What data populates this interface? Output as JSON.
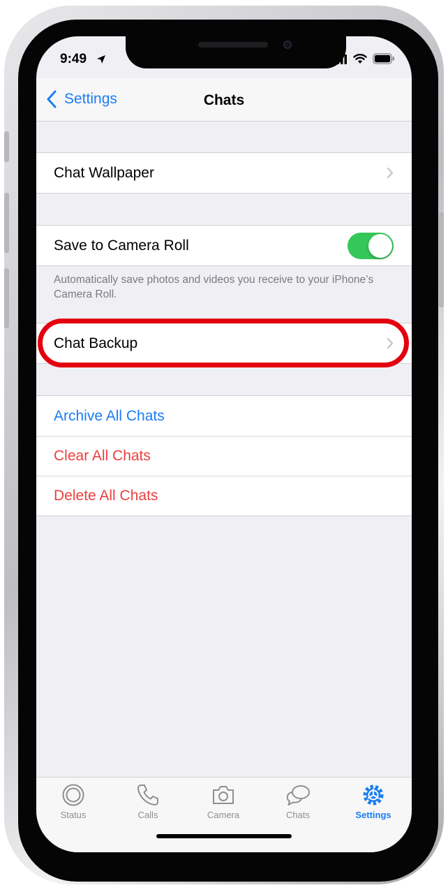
{
  "status_bar": {
    "time": "9:49"
  },
  "navbar": {
    "back_label": "Settings",
    "title": "Chats"
  },
  "group_wallpaper": {
    "label": "Chat Wallpaper"
  },
  "group_camera_roll": {
    "label": "Save to Camera Roll",
    "toggle_on": true,
    "footnote": "Automatically save photos and videos you receive to your iPhone’s Camera Roll."
  },
  "group_backup": {
    "label": "Chat Backup"
  },
  "group_actions": {
    "archive": "Archive All Chats",
    "clear": "Clear All Chats",
    "delete": "Delete All Chats"
  },
  "tabbar": {
    "tabs": [
      {
        "label": "Status",
        "icon": "status-icon"
      },
      {
        "label": "Calls",
        "icon": "phone-icon"
      },
      {
        "label": "Camera",
        "icon": "camera-icon"
      },
      {
        "label": "Chats",
        "icon": "chat-bubbles-icon"
      },
      {
        "label": "Settings",
        "icon": "gear-icon",
        "active": true
      }
    ]
  },
  "colors": {
    "accent": "#1a7ef2",
    "destructive": "#e8403f",
    "toggle_on": "#35c759",
    "highlight": "#e4000f"
  }
}
